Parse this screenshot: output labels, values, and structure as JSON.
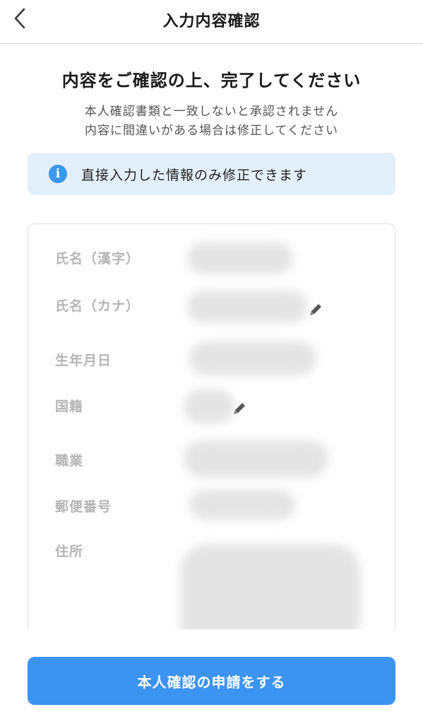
{
  "header": {
    "title": "入力内容確認",
    "back_icon": "chevron-left-icon"
  },
  "intro": {
    "heading": "内容をご確認の上、完了してください",
    "line1": "本人確認書類と一致しないと承認されません",
    "line2": "内容に間違いがある場合は修正してください"
  },
  "notice": {
    "icon": "info-icon",
    "icon_glyph": "i",
    "text": "直接入力した情報のみ修正できます"
  },
  "fields": [
    {
      "label": "氏名（漢字）",
      "editable": false
    },
    {
      "label": "氏名（カナ）",
      "editable": true
    },
    {
      "label": "生年月日",
      "editable": false
    },
    {
      "label": "国籍",
      "editable": true
    },
    {
      "label": "職業",
      "editable": false
    },
    {
      "label": "郵便番号",
      "editable": false
    },
    {
      "label": "住所",
      "editable": false
    }
  ],
  "submit": {
    "label": "本人確認の申請をする"
  },
  "colors": {
    "accent": "#3b94f2",
    "info_bg": "#e3f0fb",
    "label_gray": "#b5b5b5"
  }
}
